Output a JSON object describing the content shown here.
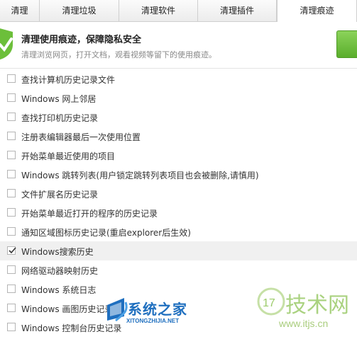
{
  "tabs": [
    {
      "label": "清理"
    },
    {
      "label": "清理垃圾"
    },
    {
      "label": "清理软件"
    },
    {
      "label": "清理插件"
    },
    {
      "label": "清理痕迹"
    }
  ],
  "active_tab": "清理痕迹",
  "header": {
    "title": "清理使用痕迹，保障隐私安全",
    "subtitle": "清理浏览网页，打开文档，观看视频等留下的使用痕迹。"
  },
  "items": [
    {
      "label": "查找计算机历史记录文件",
      "checked": false
    },
    {
      "label": "Windows 网上邻居",
      "checked": false
    },
    {
      "label": "查找打印机历史记录",
      "checked": false
    },
    {
      "label": "注册表编辑器最后一次使用位置",
      "checked": false
    },
    {
      "label": "开始菜单最近使用的项目",
      "checked": false
    },
    {
      "label": "Windows 跳转列表(用户锁定跳转列表项目也会被删除,请慎用)",
      "checked": false
    },
    {
      "label": "文件扩展名历史记录",
      "checked": false
    },
    {
      "label": "开始菜单最近打开的程序的历史记录",
      "checked": false
    },
    {
      "label": "通知区域图标历史记录(重启explorer后生效)",
      "checked": false
    },
    {
      "label": "Windows搜索历史",
      "checked": true
    },
    {
      "label": "网络驱动器映射历史",
      "checked": false
    },
    {
      "label": "Windows 系统日志",
      "checked": false
    },
    {
      "label": "Windows 画图历史记录",
      "checked": false
    },
    {
      "label": "Windows 控制台历史记录",
      "checked": false
    }
  ],
  "watermarks": {
    "left_title": "系统之家",
    "left_sub": "XITONGZHIJIA.NET",
    "right_title": "技术网",
    "right_url": "www.itjs.cn"
  },
  "colors": {
    "accent_green": "#5aae2c",
    "watermark_blue": "#1f6fbf",
    "watermark_green": "#9ccb6a",
    "selected_row": "#f0f0f0"
  }
}
